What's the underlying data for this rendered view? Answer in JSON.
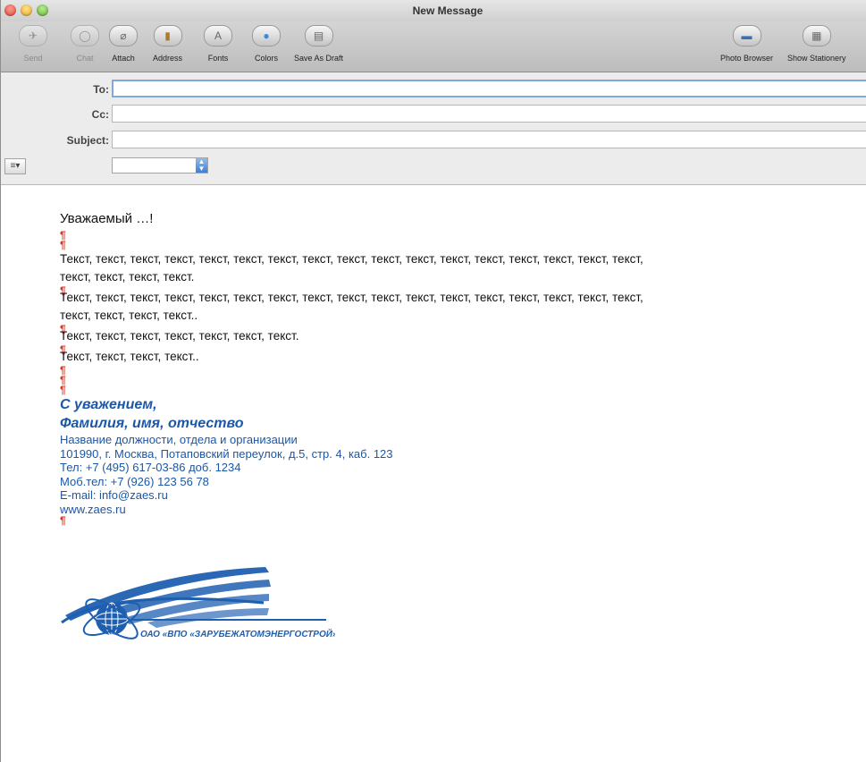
{
  "window": {
    "title": "New Message"
  },
  "toolbar": {
    "send": "Send",
    "chat": "Chat",
    "attach": "Attach",
    "address": "Address",
    "fonts": "Fonts",
    "colors": "Colors",
    "save_draft": "Save As Draft",
    "photo_browser": "Photo Browser",
    "show_stationery": "Show Stationery"
  },
  "fields": {
    "to_label": "To:",
    "to_value": "",
    "cc_label": "Cc:",
    "cc_value": "",
    "subject_label": "Subject:",
    "subject_value": "",
    "options_icon": "≡▾",
    "account_value": ""
  },
  "message": {
    "greeting": "Уважаемый …!",
    "pilcrow": "¶",
    "para1": "Текст, текст, текст, текст, текст, текст, текст, текст, текст, текст, текст, текст, текст, текст, текст, текст, текст, текст, текст, текст, текст.",
    "para2": "Текст, текст, текст, текст, текст, текст, текст, текст, текст, текст, текст, текст, текст, текст, текст, текст, текст, текст, текст, текст, текст..",
    "para3": "Текст, текст, текст, текст, текст, текст, текст.",
    "para4": "Текст, текст, текст, текст.."
  },
  "signature": {
    "closing": "С уважением,",
    "name": "Фамилия, имя, отчество",
    "position": "Название должности, отдела и организации",
    "address": "101990, г. Москва, Потаповский переулок, д.5, стр. 4, каб. 123",
    "phone": "Тел: +7 (495) 617-03-86 доб. 1234",
    "mobile": "Моб.тел: +7 (926) 123 56 78",
    "email": "E-mail: info@zaes.ru",
    "website": "www.zaes.ru",
    "logo_text": "ОАО «ВПО «ЗАРУБЕЖАТОМЭНЕРГОСТРОЙ»"
  },
  "colors": {
    "signature_blue": "#1a57a8",
    "pilcrow_red": "#d23a2a",
    "focus_ring": "#7fa8de"
  }
}
